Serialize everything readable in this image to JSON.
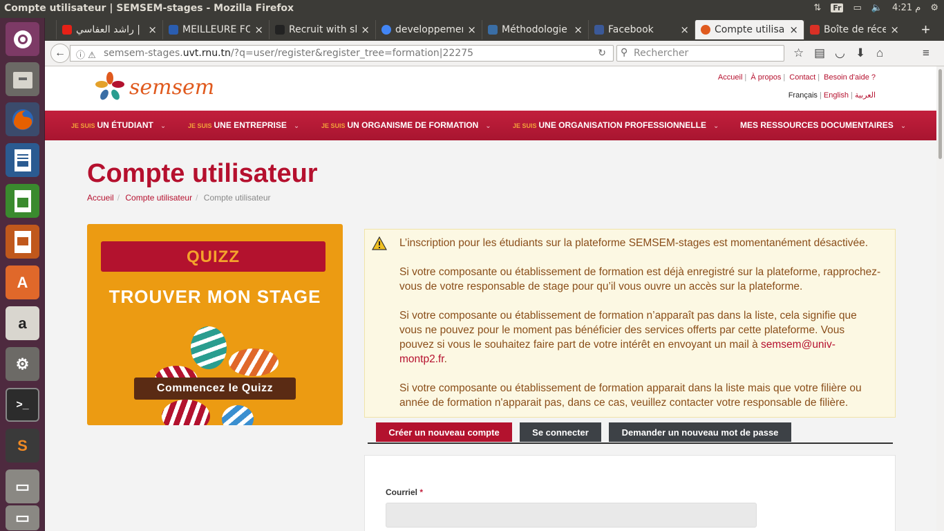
{
  "os": {
    "window_title": "Compte utilisateur | SEMSEM-stages - Mozilla Firefox",
    "keyboard_layout": "Fr",
    "clock": "4:21 م"
  },
  "browser": {
    "tabs": [
      {
        "label": "راشد العفاسي |",
        "favicon_color": "#e62117",
        "icon": "youtube-icon"
      },
      {
        "label": "MEILLEURE FO",
        "favicon_color": "#2a5db0",
        "icon": "video-icon"
      },
      {
        "label": "Recruit with sl",
        "favicon_color": "#222222",
        "icon": "site-icon"
      },
      {
        "label": "developpemen",
        "favicon_color": "#4285f4",
        "icon": "google-icon"
      },
      {
        "label": "Méthodologie",
        "favicon_color": "#3a6ea5",
        "icon": "wiki-icon"
      },
      {
        "label": "Facebook",
        "favicon_color": "#3b5998",
        "icon": "facebook-icon"
      },
      {
        "label": "Compte utilisa",
        "favicon_color": "#e05a1e",
        "icon": "semsem-icon",
        "active": true
      },
      {
        "label": "Boîte de récep",
        "favicon_color": "#d93025",
        "icon": "gmail-icon"
      }
    ],
    "url_prefix": "semsem-stages.",
    "url_domain": "uvt.rnu.tn",
    "url_rest": "/?q=user/register&register_tree=formation|22275",
    "search_placeholder": "Rechercher"
  },
  "site": {
    "logo_text": "semsem",
    "top_links": [
      "Accueil",
      "À propos",
      "Contact",
      "Besoin d'aide ?"
    ],
    "languages": {
      "current": "Français",
      "english": "English",
      "arabic": "العربية"
    },
    "menu": [
      {
        "prefix": "JE SUIS",
        "label": "UN ÉTUDIANT"
      },
      {
        "prefix": "JE SUIS",
        "label": "UNE ENTREPRISE"
      },
      {
        "prefix": "JE SUIS",
        "label": "UN ORGANISME DE FORMATION"
      },
      {
        "prefix": "JE SUIS",
        "label": "UNE ORGANISATION PROFESSIONNELLE"
      },
      {
        "prefix": "",
        "label": "MES RESSOURCES DOCUMENTAIRES"
      }
    ],
    "brand_color": "#b5102e",
    "accent_color": "#ec9b12"
  },
  "page": {
    "title": "Compte utilisateur",
    "breadcrumb": [
      "Accueil",
      "Compte utilisateur",
      "Compte utilisateur"
    ],
    "quiz": {
      "badge": "QUIZZ",
      "subtitle": "TROUVER MON STAGE",
      "button": "Commencez le Quizz"
    },
    "notice": {
      "p1": "L’inscription pour les étudiants sur la plateforme SEMSEM-stages est momentanément désactivée.",
      "p2": "Si votre composante ou établissement de formation est déjà enregistré sur la plateforme, rapprochez-vous de votre responsable de stage pour qu’il vous ouvre un accès sur la plateforme.",
      "p3": "Si votre composante ou établissement de formation n’apparaît pas dans la liste, cela signifie que vous ne pouvez pour le moment pas bénéficier des services offerts par cette plateforme. Vous pouvez si vous le souhaitez faire part de votre intérêt en envoyant un mail à",
      "p3_email": "semsem@univ-montp2.fr",
      "p3_end": ".",
      "p4": "Si votre composante ou établissement de formation apparait dans la liste mais que votre filière ou année de formation n'apparait pas, dans ce cas, veuillez contacter votre responsable de filière."
    },
    "account_tabs": [
      "Créer un nouveau compte",
      "Se connecter",
      "Demander un nouveau mot de passe"
    ],
    "form": {
      "email_label": "Courriel",
      "required_mark": "*",
      "email_value": ""
    }
  }
}
